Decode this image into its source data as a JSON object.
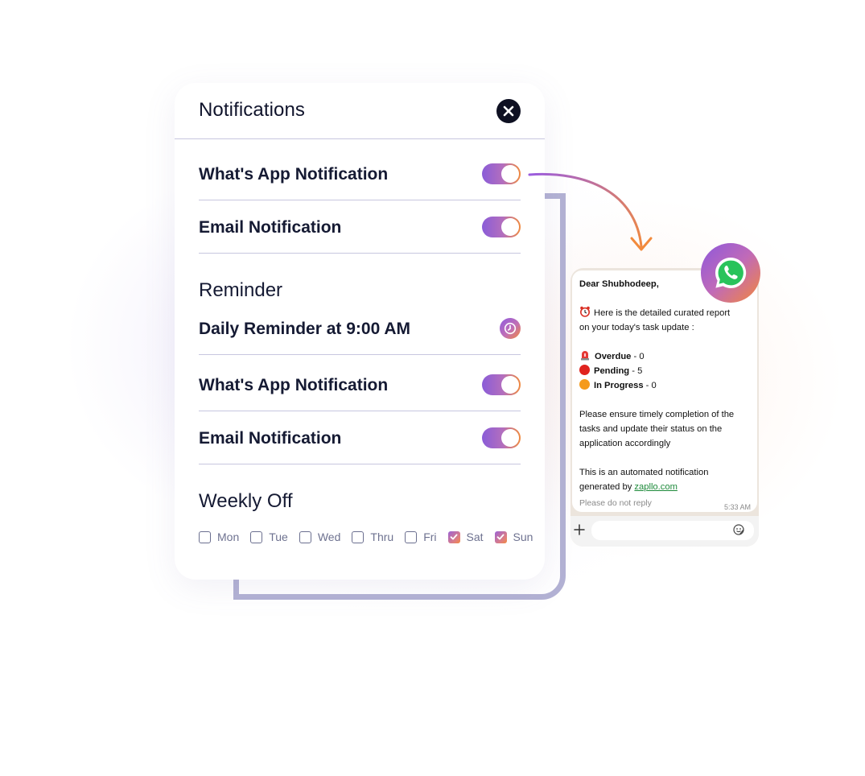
{
  "panel": {
    "title": "Notifications",
    "whatsapp_label": "What's App Notification",
    "email_label": "Email Notification",
    "whatsapp_enabled": true,
    "email_enabled": true
  },
  "reminder": {
    "heading": "Reminder",
    "daily_label": "Daily Reminder at 9:00 AM",
    "whatsapp_label": "What's App Notification",
    "email_label": "Email Notification",
    "whatsapp_enabled": true,
    "email_enabled": true
  },
  "weekly_off": {
    "heading": "Weekly Off",
    "days": [
      {
        "label": "Mon",
        "checked": false
      },
      {
        "label": "Tue",
        "checked": false
      },
      {
        "label": "Wed",
        "checked": false
      },
      {
        "label": "Thru",
        "checked": false
      },
      {
        "label": "Fri",
        "checked": false
      },
      {
        "label": "Sat",
        "checked": true
      },
      {
        "label": "Sun",
        "checked": true
      }
    ]
  },
  "whatsapp_message": {
    "greeting": "Dear Shubhodeep,",
    "intro_line1": "Here is the detailed curated report",
    "intro_line2": "on your today's task update :",
    "overdue_label": "Overdue",
    "overdue_value": "- 0",
    "pending_label": "Pending",
    "pending_value": "- 5",
    "inprogress_label": "In Progress",
    "inprogress_value": "- 0",
    "body_line1": "Please ensure timely completion of the",
    "body_line2": "tasks and update their status on the",
    "body_line3": "application accordingly",
    "auto_line1": "This is an automated notification",
    "auto_line2_prefix": "generated by",
    "link": "zapllo.com",
    "footer": "Please do not reply",
    "time": "5:33 AM"
  },
  "icons": {
    "close": "close-icon",
    "clock": "clock-icon",
    "whatsapp": "whatsapp-icon",
    "alarm": "alarm-clock-icon",
    "siren": "siren-icon",
    "red_circle": "red-circle-icon",
    "orange_circle": "orange-circle-icon",
    "plus": "plus-icon",
    "sticker": "sticker-icon",
    "check": "check-icon"
  },
  "colors": {
    "accent_purple": "#8a5cd8",
    "accent_orange": "#f08a3e",
    "text_dark": "#151a33",
    "divider": "#c7c6df",
    "frame": "#b3b2d4",
    "link_green": "#1d8a3a"
  }
}
